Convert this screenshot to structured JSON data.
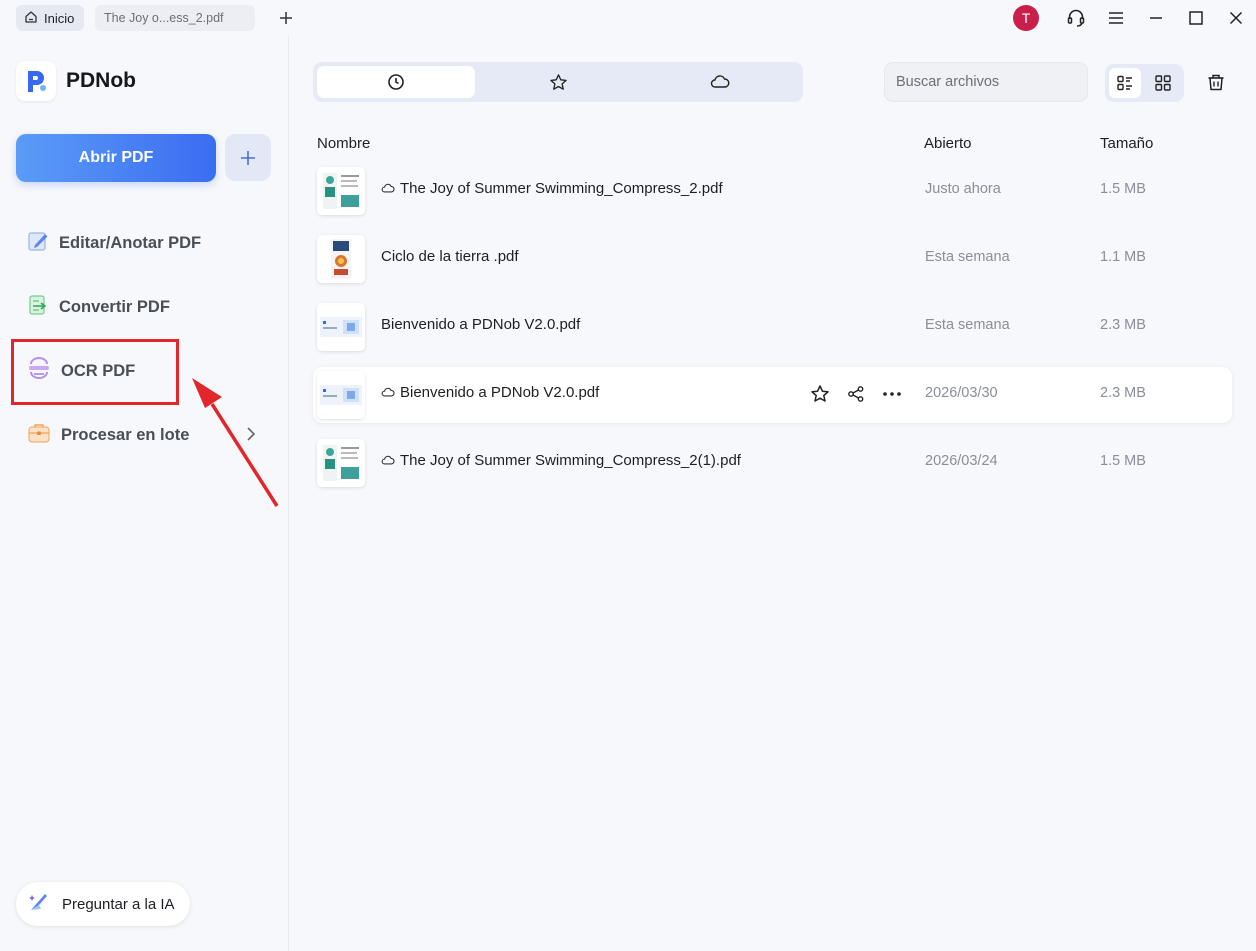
{
  "titlebar": {
    "home_tab": "Inicio",
    "doc_tab": "The Joy o...ess_2.pdf",
    "avatar_letter": "T"
  },
  "sidebar": {
    "logo": "PDNob",
    "open_button": "Abrir PDF",
    "items": [
      {
        "label": "Editar/Anotar PDF",
        "icon": "edit-icon"
      },
      {
        "label": "Convertir PDF",
        "icon": "convert-icon"
      },
      {
        "label": "OCR PDF",
        "icon": "ocr-icon"
      },
      {
        "label": "Procesar en lote",
        "icon": "batch-icon"
      }
    ],
    "ai_button": "Preguntar a la IA"
  },
  "main": {
    "tabs": [
      "recent",
      "favorites",
      "cloud"
    ],
    "search_placeholder": "Buscar archivos",
    "columns": {
      "name": "Nombre",
      "opened": "Abierto",
      "size": "Tamaño"
    },
    "files": [
      {
        "name": "The Joy of Summer Swimming_Compress_2.pdf",
        "opened": "Justo ahora",
        "size": "1.5 MB",
        "cloud": true
      },
      {
        "name": "Ciclo de la tierra .pdf",
        "opened": "Esta semana",
        "size": "1.1 MB",
        "cloud": false
      },
      {
        "name": "Bienvenido a PDNob V2.0.pdf",
        "opened": "Esta semana",
        "size": "2.3 MB",
        "cloud": false
      },
      {
        "name": "Bienvenido a PDNob V2.0.pdf",
        "opened": "2026/03/30",
        "size": "2.3 MB",
        "cloud": true
      },
      {
        "name": "The Joy of Summer Swimming_Compress_2(1).pdf",
        "opened": "2026/03/24",
        "size": "1.5 MB",
        "cloud": true
      }
    ]
  },
  "colors": {
    "accent": "#3b6cf0",
    "highlight": "#e3262a",
    "avatar": "#c91f4a"
  }
}
